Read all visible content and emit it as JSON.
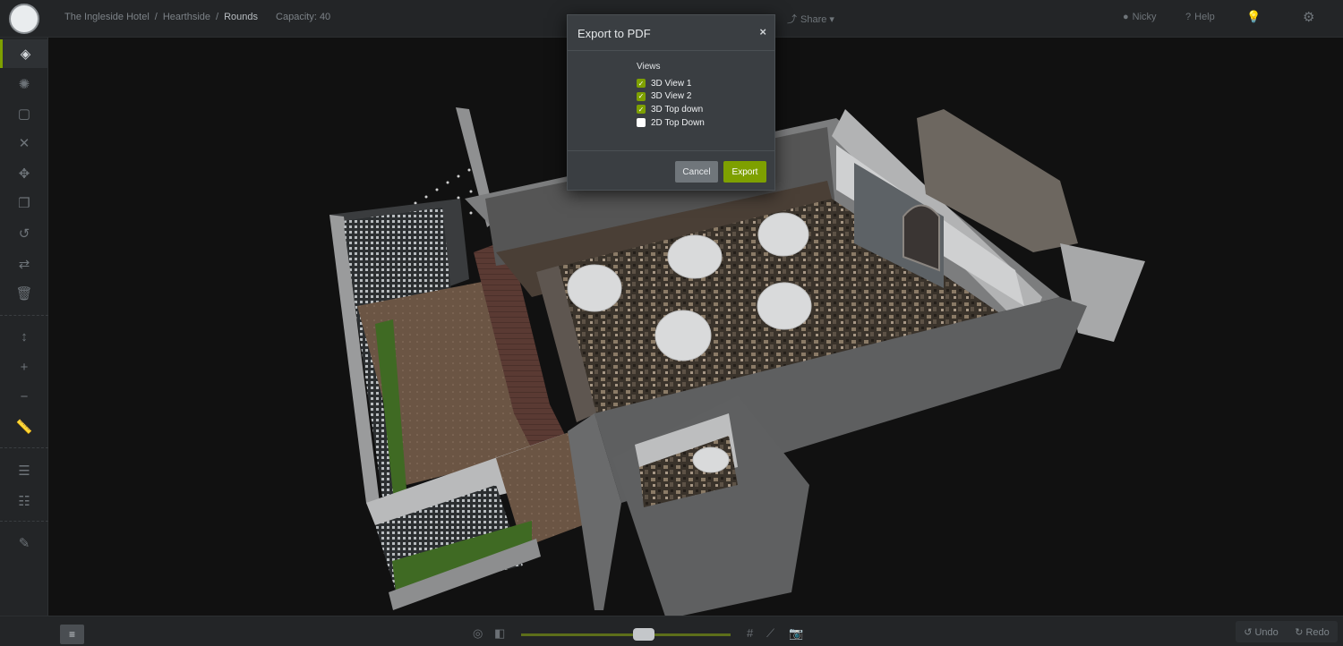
{
  "breadcrumb": {
    "items": [
      "The Ingleside Hotel",
      "Hearthside",
      "Rounds"
    ],
    "separator": "/",
    "capacity": "Capacity: 40"
  },
  "topnav": {
    "share": "Share",
    "user": "Nicky",
    "help": "Help"
  },
  "sidebar": {
    "tools": [
      "cube-icon",
      "sun-icon",
      "frame-icon",
      "close-icon",
      "move-icon",
      "copy-icon",
      "rotate-icon",
      "swap-icon",
      "trash-icon",
      "height-icon",
      "plus-icon",
      "minus-icon",
      "ruler-icon",
      "align-top-icon",
      "align-middle-icon",
      "edit-icon"
    ],
    "active": "cube-icon"
  },
  "dialog": {
    "title": "Export to PDF",
    "group_label": "Views",
    "options": [
      {
        "label": "3D View 1",
        "checked": true
      },
      {
        "label": "3D View 2",
        "checked": true
      },
      {
        "label": "3D Top down",
        "checked": true
      },
      {
        "label": "2D Top Down",
        "checked": false
      }
    ],
    "cancel": "Cancel",
    "export": "Export"
  },
  "bottombar": {
    "zoom_level": 0.6,
    "undo": "Undo",
    "redo": "Redo"
  },
  "colors": {
    "accent": "#7ea000",
    "panel": "#232527",
    "dialog": "#3a3e42"
  }
}
